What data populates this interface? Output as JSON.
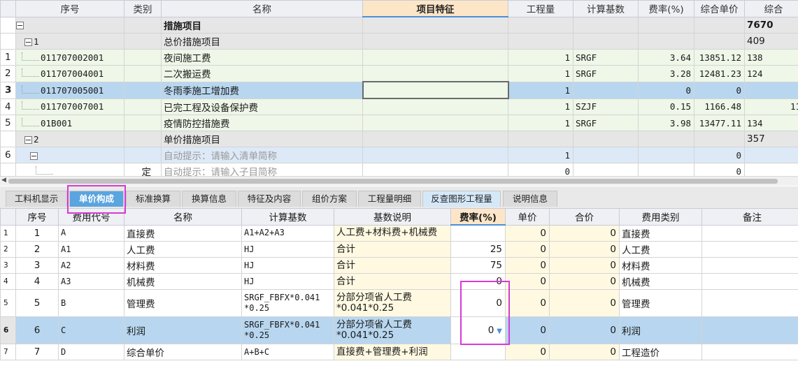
{
  "top_grid": {
    "headers": [
      "序号",
      "类别",
      "名称",
      "项目特征",
      "工程量",
      "计算基数",
      "费率(%)",
      "综合单价",
      "综合"
    ],
    "rows": [
      {
        "rn": "",
        "code": "",
        "type": "",
        "name": "措施项目",
        "qty": "",
        "base": "",
        "rate": "",
        "unit_price": "",
        "total": "7670"
      },
      {
        "rn": "",
        "code": "1",
        "type": "",
        "name": "总价措施项目",
        "qty": "",
        "base": "",
        "rate": "",
        "unit_price": "",
        "total": "409"
      },
      {
        "rn": "1",
        "code": "011707002001",
        "type": "",
        "name": "夜间施工费",
        "qty": "1",
        "base": "SRGF",
        "rate": "3.64",
        "unit_price": "13851.12",
        "total": "138"
      },
      {
        "rn": "2",
        "code": "011707004001",
        "type": "",
        "name": "二次搬运费",
        "qty": "1",
        "base": "SRGF",
        "rate": "3.28",
        "unit_price": "12481.23",
        "total": "124"
      },
      {
        "rn": "3",
        "code": "011707005001",
        "type": "",
        "name": "冬雨季施工增加费",
        "qty": "1",
        "base": "",
        "rate": "0",
        "unit_price": "0",
        "total": ""
      },
      {
        "rn": "4",
        "code": "011707007001",
        "type": "",
        "name": "已完工程及设备保护费",
        "qty": "1",
        "base": "SZJF",
        "rate": "0.15",
        "unit_price": "1166.48",
        "total": "11"
      },
      {
        "rn": "5",
        "code": "01B001",
        "type": "",
        "name": "疫情防控措施费",
        "qty": "1",
        "base": "SRGF",
        "rate": "3.98",
        "unit_price": "13477.11",
        "total": "134"
      },
      {
        "rn": "",
        "code": "2",
        "type": "",
        "name": "单价措施项目",
        "qty": "",
        "base": "",
        "rate": "",
        "unit_price": "",
        "total": "357"
      },
      {
        "rn": "6",
        "code": "",
        "type": "",
        "name": "自动提示：请输入清单简称",
        "qty": "1",
        "base": "",
        "rate": "",
        "unit_price": "0",
        "total": ""
      },
      {
        "rn": "",
        "code": "",
        "type": "定",
        "name": "自动提示：请输入子目简称",
        "qty": "0",
        "base": "",
        "rate": "",
        "unit_price": "0",
        "total": ""
      }
    ]
  },
  "tabs": [
    "工料机显示",
    "单价构成",
    "标准换算",
    "换算信息",
    "特征及内容",
    "组价方案",
    "工程量明细",
    "反查图形工程量",
    "说明信息"
  ],
  "bottom_grid": {
    "headers": [
      "序号",
      "费用代号",
      "名称",
      "计算基数",
      "基数说明",
      "费率(%)",
      "单价",
      "合价",
      "费用类别",
      "备注"
    ],
    "rows": [
      {
        "rn": "1",
        "no": "1",
        "code": "A",
        "name": "直接费",
        "base": "A1+A2+A3",
        "desc": "人工费+材料费+机械费",
        "rate": "",
        "unit": "0",
        "total": "0",
        "cat": "直接费",
        "note": ""
      },
      {
        "rn": "2",
        "no": "2",
        "code": "A1",
        "name": "人工费",
        "base": "HJ",
        "desc": "合计",
        "rate": "25",
        "unit": "0",
        "total": "0",
        "cat": "人工费",
        "note": ""
      },
      {
        "rn": "3",
        "no": "3",
        "code": "A2",
        "name": "材料费",
        "base": "HJ",
        "desc": "合计",
        "rate": "75",
        "unit": "0",
        "total": "0",
        "cat": "材料费",
        "note": ""
      },
      {
        "rn": "4",
        "no": "4",
        "code": "A3",
        "name": "机械费",
        "base": "HJ",
        "desc": "合计",
        "rate": "0",
        "unit": "0",
        "total": "0",
        "cat": "机械费",
        "note": ""
      },
      {
        "rn": "5",
        "no": "5",
        "code": "B",
        "name": "管理费",
        "base_l1": "SRGF_FBFX*0.041",
        "base_l2": "*0.25",
        "desc_l1": "分部分项省人工费",
        "desc_l2": "*0.041*0.25",
        "rate": "0",
        "unit": "0",
        "total": "0",
        "cat": "管理费",
        "note": ""
      },
      {
        "rn": "6",
        "no": "6",
        "code": "C",
        "name": "利润",
        "base_l1": "SRGF_FBFX*0.041",
        "base_l2": "*0.25",
        "desc_l1": "分部分项省人工费",
        "desc_l2": "*0.041*0.25",
        "rate": "0",
        "unit": "0",
        "total": "0",
        "cat": "利润",
        "note": ""
      },
      {
        "rn": "7",
        "no": "7",
        "code": "D",
        "name": "综合单价",
        "base": "A+B+C",
        "desc": "直接费+管理费+利润",
        "rate": "",
        "unit": "0",
        "total": "0",
        "cat": "工程造价",
        "note": ""
      }
    ]
  },
  "colors": {
    "accent": "#5aa4e0",
    "selected_row": "#b8d6ef",
    "highlight_box": "#d63bd6",
    "header_active": "#fde6c8"
  }
}
